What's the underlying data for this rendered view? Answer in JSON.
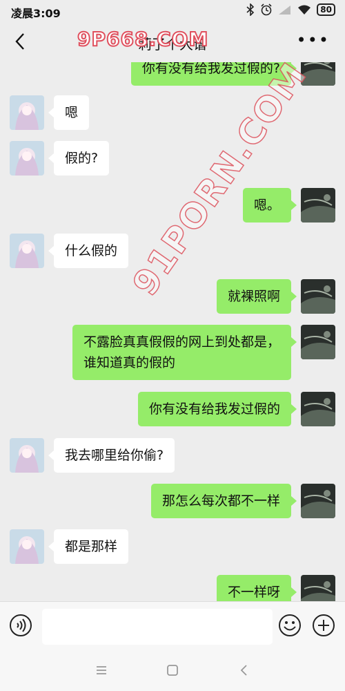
{
  "status": {
    "time": "凌晨3:09",
    "battery": "80"
  },
  "header": {
    "title": "莉了个大谱"
  },
  "watermarks": {
    "top": "9P668.COM",
    "diagonal": "91PORN.COM"
  },
  "messages": [
    {
      "side": "right",
      "text": "你有没有给我发过假的?"
    },
    {
      "side": "left",
      "text": "嗯"
    },
    {
      "side": "left",
      "text": "假的?"
    },
    {
      "side": "right",
      "text": "嗯。"
    },
    {
      "side": "left",
      "text": "什么假的"
    },
    {
      "side": "right",
      "text": "就裸照啊"
    },
    {
      "side": "right",
      "text": "不露脸真真假假的网上到处都是，\n谁知道真的假的"
    },
    {
      "side": "right",
      "text": "你有没有给我发过假的"
    },
    {
      "side": "left",
      "text": "我去哪里给你偷?"
    },
    {
      "side": "right",
      "text": "那怎么每次都不一样"
    },
    {
      "side": "left",
      "text": "都是那样"
    },
    {
      "side": "right",
      "text": "不一样呀"
    }
  ],
  "input": {
    "value": "",
    "placeholder": ""
  },
  "colors": {
    "bubble_self": "#95ec69",
    "bubble_other": "#ffffff",
    "background": "#ededed"
  }
}
